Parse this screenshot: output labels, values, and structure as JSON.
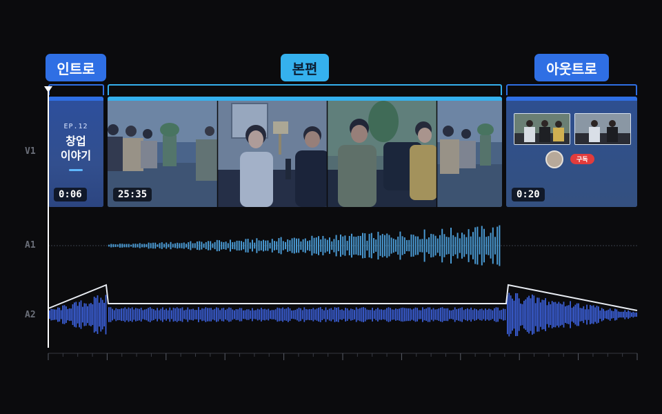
{
  "sections": {
    "intro": {
      "label": "인트로",
      "duration": "0:06",
      "ep": "EP.12",
      "title_line1": "창업",
      "title_line2": "이야기"
    },
    "main": {
      "label": "본편",
      "duration": "25:35"
    },
    "outro": {
      "label": "아웃트로",
      "duration": "0:20",
      "subscribe": "구독"
    }
  },
  "tracks": {
    "video": "V1",
    "audio1": "A1",
    "audio2": "A2"
  },
  "colors": {
    "background": "#0b0b0d",
    "blue": "#2f6fe4",
    "cyan": "#35b1ee",
    "a1_wave": "#4a9ad3",
    "a2_wave": "#3b5fd6",
    "subscribe": "#e23c3c"
  }
}
